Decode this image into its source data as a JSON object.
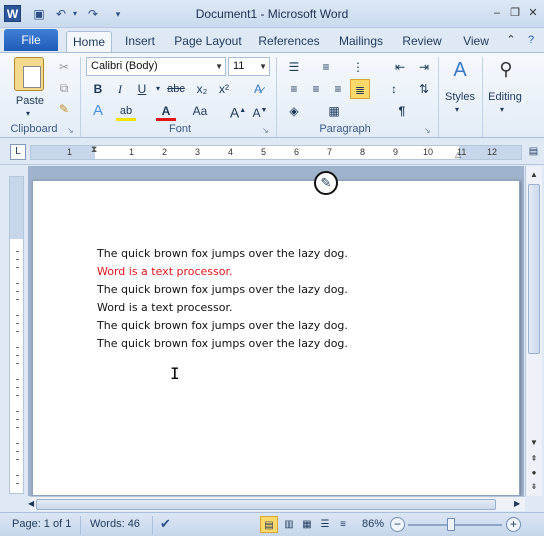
{
  "titlebar": {
    "title": "Document1  -  Microsoft Word",
    "app_icon": "W",
    "qat": [
      {
        "name": "save-icon",
        "glyph": "💾"
      },
      {
        "name": "undo-icon",
        "glyph": "↶"
      },
      {
        "name": "redo-icon",
        "glyph": "↷"
      },
      {
        "name": "customize-qat-icon",
        "glyph": "▾"
      }
    ]
  },
  "tabs": {
    "file": "File",
    "items": [
      "Home",
      "Insert",
      "Page Layout",
      "References",
      "Mailings",
      "Review",
      "View"
    ],
    "active": "Home"
  },
  "ribbon": {
    "clipboard": {
      "label": "Clipboard",
      "paste": "Paste"
    },
    "font": {
      "label": "Font",
      "family": "Calibri (Body)",
      "size": "11"
    },
    "paragraph": {
      "label": "Paragraph"
    },
    "styles": {
      "label": "Styles"
    },
    "editing": {
      "label": "Editing"
    }
  },
  "ruler": {
    "numbers": [
      "1",
      "2",
      "3",
      "4",
      "5",
      "6",
      "7",
      "8",
      "9",
      "10",
      "11",
      "12"
    ],
    "tab_glyph": "L"
  },
  "document": {
    "lines": [
      {
        "text": "The quick brown fox jumps over the lazy dog.",
        "color": "#111111"
      },
      {
        "text": "Word is a text processor.",
        "color": "#e0161b"
      },
      {
        "text": "The quick brown fox jumps over the lazy dog.",
        "color": "#111111"
      },
      {
        "text": "Word is a text processor.",
        "color": "#111111"
      },
      {
        "text": "The quick brown fox jumps over the lazy dog.",
        "color": "#111111"
      },
      {
        "text": "The quick brown fox jumps over the lazy dog.",
        "color": "#111111"
      }
    ]
  },
  "statusbar": {
    "page": "Page: 1 of 1",
    "words": "Words: 46",
    "zoom": "86%",
    "zoom_fraction": 0.5
  }
}
